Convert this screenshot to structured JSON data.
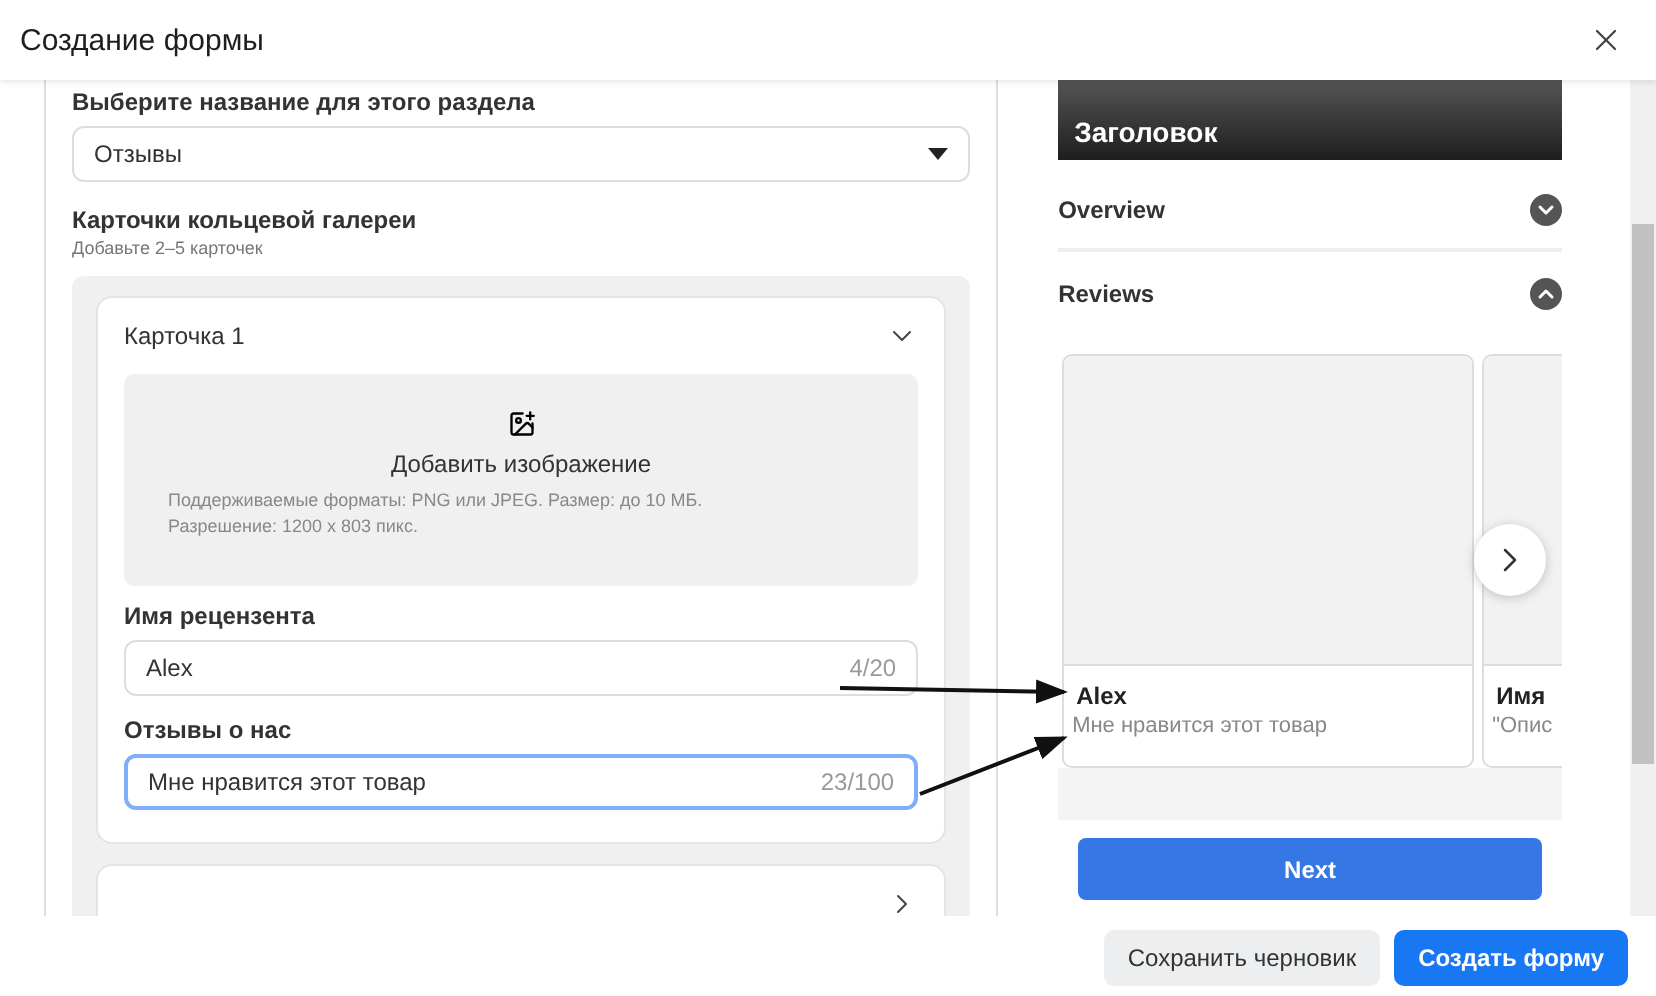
{
  "window": {
    "title": "Создание формы"
  },
  "form": {
    "section_label": "Выберите название для этого раздела",
    "section_value": "Отзывы",
    "gallery_title": "Карточки кольцевой галереи",
    "gallery_hint": "Добавьте 2–5 карточек",
    "cards": [
      {
        "title": "Карточка 1",
        "expanded": true,
        "upload_label": "Добавить изображение",
        "upload_hint": "Поддерживаемые форматы: PNG или JPEG. Размер: до 10 МБ. Разрешение: 1200 x 803 пикс.",
        "fields": [
          {
            "label": "Имя рецензента",
            "value": "Alex",
            "counter": "4/20",
            "focused": false
          },
          {
            "label": "Отзывы о нас",
            "value": "Мне нравится этот товар",
            "counter": "23/100",
            "focused": true
          }
        ]
      },
      {
        "expanded": false
      }
    ]
  },
  "preview": {
    "header_title": "Заголовок",
    "sections": [
      {
        "label": "Overview",
        "expanded": false
      },
      {
        "label": "Reviews",
        "expanded": true
      }
    ],
    "review_cards": [
      {
        "name": "Alex",
        "text": "Мне нравится этот товар"
      },
      {
        "name": "Имя",
        "text": "\"Опис"
      }
    ],
    "next_button": "Next"
  },
  "footer": {
    "buttons": [
      {
        "label": "Сохранить черновик",
        "kind": "secondary"
      },
      {
        "label": "Создать форму",
        "kind": "primary"
      }
    ]
  }
}
